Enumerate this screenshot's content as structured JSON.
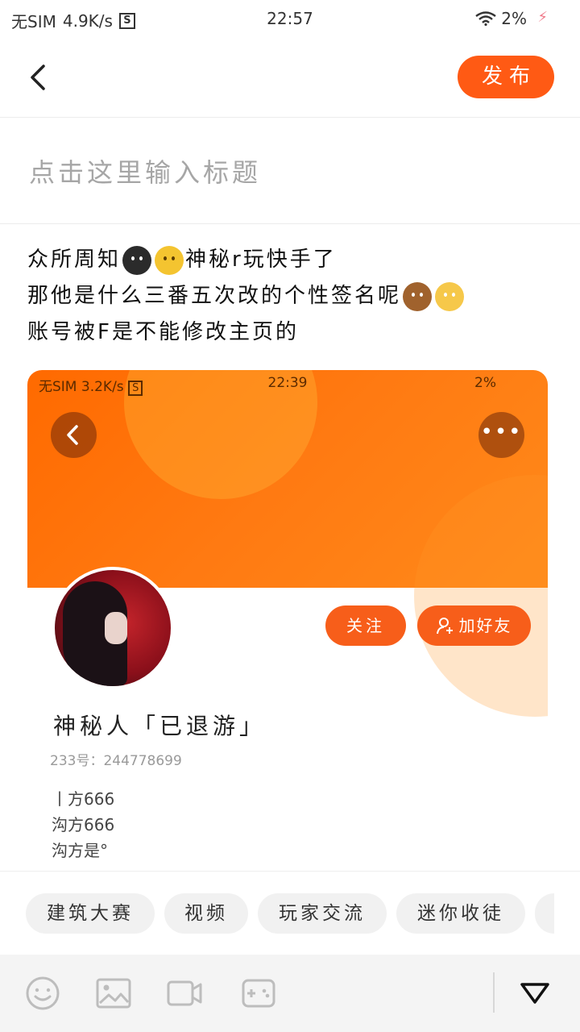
{
  "status_bar": {
    "carrier": "无SIM",
    "speed": "4.9K/s",
    "sim_icon": "S",
    "time": "22:57",
    "battery": "2%"
  },
  "header": {
    "back_icon": "chevron-left-icon",
    "publish_label": "发布"
  },
  "title_field": {
    "placeholder": "点击这里输入标题",
    "value": ""
  },
  "body": {
    "line1_prefix": "众所周知",
    "line1_suffix": "神秘r玩快手了",
    "line2": "那他是什么三番五次改的个性签名呢",
    "line3": "账号被F是不能修改主页的"
  },
  "embedded_screenshot": {
    "status": {
      "carrier": "无SIM",
      "speed": "3.2K/s",
      "sim_icon": "S",
      "time": "22:39",
      "battery": "2%"
    },
    "more_label": "•••",
    "follow_label": "关注",
    "add_friend_label": "加好友",
    "profile_name": "神秘人「已退游」",
    "profile_id": "233号：244778699",
    "bio_lines": [
      "丨方666",
      "沟方666",
      "沟方是°"
    ]
  },
  "tags": [
    "建筑大赛",
    "视频",
    "玩家交流",
    "迷你收徒"
  ],
  "toolbar": {
    "icons": [
      "emoji-icon",
      "image-icon",
      "video-icon",
      "game-icon"
    ],
    "collapse_icon": "triangle-down-icon"
  },
  "colors": {
    "accent": "#ff5a14",
    "banner": "#ff7a12",
    "tag_bg": "#f1f1f1",
    "toolbar_bg": "#f4f4f4"
  }
}
